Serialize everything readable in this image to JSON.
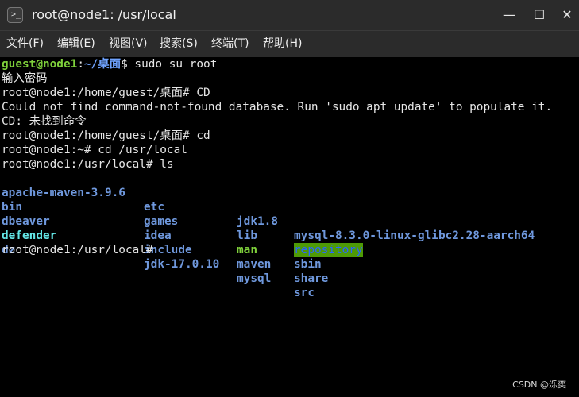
{
  "window": {
    "title": "root@node1: /usr/local",
    "icon": "terminal-icon",
    "minimize_glyph": "—",
    "maximize_glyph": "☐",
    "close_glyph": "✕"
  },
  "menu": {
    "items": [
      {
        "label": "文件(F)"
      },
      {
        "label": "编辑(E)"
      },
      {
        "label": "视图(V)"
      },
      {
        "label": "搜索(S)"
      },
      {
        "label": "终端(T)"
      },
      {
        "label": "帮助(H)"
      }
    ]
  },
  "terminal": {
    "line1": {
      "user": "guest@node1",
      "sep": ":",
      "path": "~/桌面",
      "rest": "$ sudo su root"
    },
    "line2": "输入密码",
    "line3": "root@node1:/home/guest/桌面# CD",
    "line4": "Could not find command-not-found database. Run 'sudo apt update' to populate it.",
    "line5": "CD: 未找到命令",
    "line6": "root@node1:/home/guest/桌面# cd",
    "line7": "root@node1:~# cd /usr/local",
    "line8": "root@node1:/usr/local# ls",
    "ls": {
      "row1": [
        "apache-maven-3.9.6",
        "etc",
        "jdk1.8",
        "mysql-8.3.0-linux-glibc2.28-aarch64"
      ],
      "row2": [
        "bin",
        "games",
        "lib",
        "repository"
      ],
      "row3": [
        "dbeaver",
        "idea",
        "man",
        "sbin"
      ],
      "row4": [
        "defender",
        "include",
        "maven",
        "share"
      ],
      "row5": [
        "dz",
        "jdk-17.0.10",
        "mysql",
        "src"
      ]
    },
    "final_prompt": "root@node1:/usr/local#"
  },
  "colors": {
    "user": "#7fd13b",
    "path": "#6fa3ff",
    "directory": "#6f98dd",
    "executable": "#63e6e6",
    "repository_bg": "#4e9a06"
  },
  "watermark": "CSDN @泺奕"
}
